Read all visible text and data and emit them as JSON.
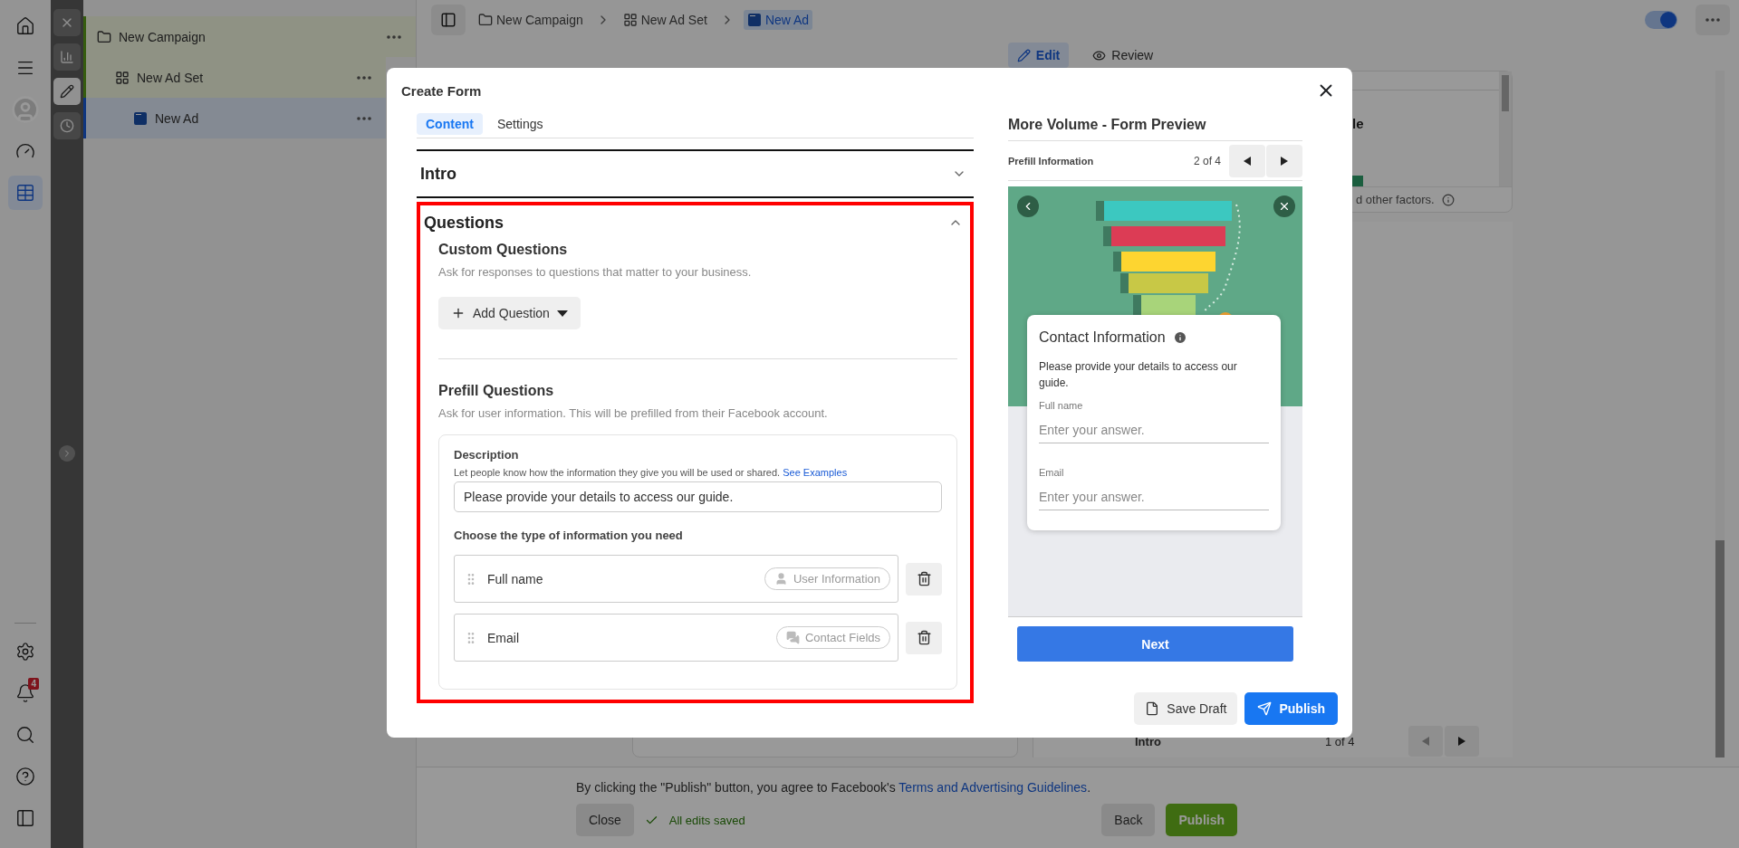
{
  "nav_rail": {
    "items": [
      {
        "kind": "home",
        "selected": false
      },
      {
        "kind": "menu",
        "selected": false
      },
      {
        "kind": "avatar",
        "selected": false
      },
      {
        "kind": "dashboard",
        "selected": false
      },
      {
        "kind": "table",
        "selected": true
      }
    ],
    "bottom_items": [
      {
        "kind": "settings"
      },
      {
        "kind": "notifications",
        "badge": "4"
      },
      {
        "kind": "search"
      },
      {
        "kind": "help"
      },
      {
        "kind": "panel"
      }
    ]
  },
  "tool_rail": {
    "items": [
      {
        "kind": "close",
        "selected": false
      },
      {
        "kind": "chart",
        "selected": false
      },
      {
        "kind": "edit",
        "selected": true
      },
      {
        "kind": "history",
        "selected": false
      }
    ]
  },
  "tree": [
    {
      "label": "New Campaign",
      "kind": "campaign",
      "selected": false,
      "children": [
        {
          "label": "New Ad Set",
          "kind": "adset",
          "selected": false,
          "children": [
            {
              "label": "New Ad",
              "kind": "ad",
              "selected": true
            }
          ]
        }
      ]
    }
  ],
  "breadcrumb": [
    {
      "label": "New Campaign",
      "kind": "campaign",
      "selected": false
    },
    {
      "label": "New Ad Set",
      "kind": "adset",
      "selected": false
    },
    {
      "label": "New Ad",
      "kind": "ad",
      "selected": true
    }
  ],
  "publish_toggle": {
    "on": true
  },
  "view_tabs": [
    {
      "label": "Edit",
      "kind": "edit",
      "selected": true
    },
    {
      "label": "Review",
      "kind": "review",
      "selected": false
    }
  ],
  "background": {
    "card_heading": "le",
    "note": "d other factors.",
    "preview_nav": {
      "step": "Intro",
      "position": "1 of 4"
    }
  },
  "footer": {
    "notice": "By clicking the \"Publish\" button, you agree to Facebook's ",
    "notice_link": "Terms and Advertising Guidelines",
    "notice_end": ".",
    "close_button": "Close",
    "save_status": "All edits saved",
    "back_button": "Back",
    "publish_button": "Publish"
  },
  "modal": {
    "title": "Create Form",
    "tabs": [
      {
        "label": "Content",
        "selected": true
      },
      {
        "label": "Settings",
        "selected": false
      }
    ],
    "sections": [
      {
        "title": "Intro",
        "expanded": false
      },
      {
        "title": "Questions",
        "expanded": true,
        "highlighted": true
      }
    ],
    "custom_questions": {
      "title": "Custom Questions",
      "description": "Ask for responses to questions that matter to your business.",
      "add_button": "Add Question"
    },
    "prefill_questions": {
      "title": "Prefill Questions",
      "description": "Ask for user information. This will be prefilled from their Facebook account.",
      "description_label": "Description",
      "description_help": "Let people know how the information they give you will be used or shared. ",
      "examples_link": "See Examples",
      "description_value": "Please provide your details to access our guide.",
      "choose_label": "Choose the type of information you need",
      "rows": [
        {
          "label": "Full name",
          "tag": "User Information",
          "kind": "user"
        },
        {
          "label": "Email",
          "tag": "Contact Fields",
          "kind": "contact"
        }
      ]
    },
    "preview": {
      "title": "More Volume - Form Preview",
      "step": "Prefill Information",
      "position": "2 of 4",
      "card": {
        "title": "Contact Information",
        "text": "Please provide your details to access our guide.",
        "fields": [
          {
            "label": "Full name",
            "placeholder": "Enter your answer."
          },
          {
            "label": "Email",
            "placeholder": "Enter your answer."
          }
        ]
      },
      "next_button": "Next"
    },
    "save_button": "Save Draft",
    "publish_button": "Publish"
  }
}
